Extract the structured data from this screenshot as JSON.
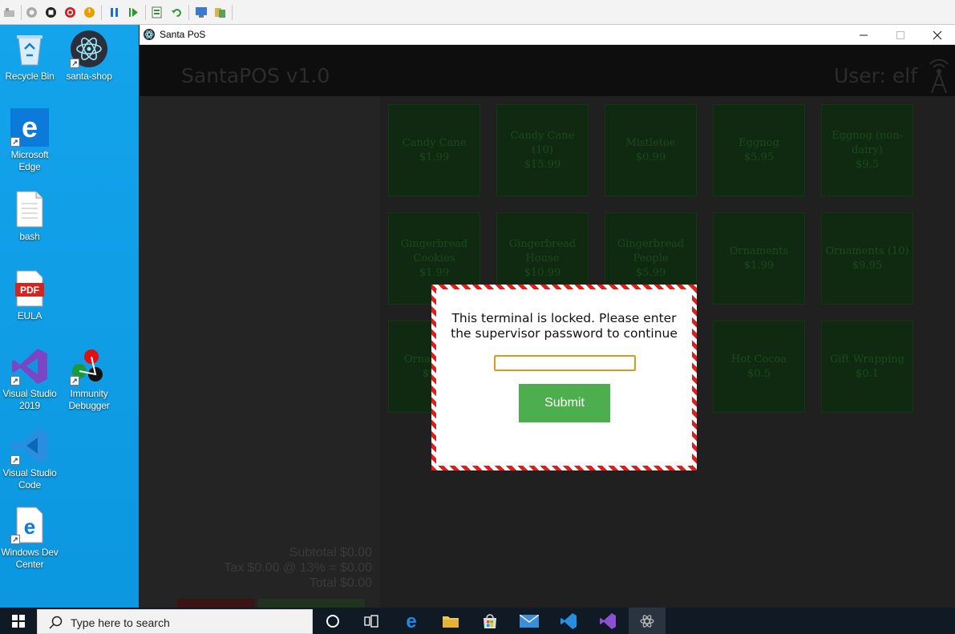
{
  "window": {
    "title": "Santa PoS",
    "minimize": "—",
    "maximize": "☐",
    "close": "✕"
  },
  "desktop_icons": [
    {
      "label": "Recycle Bin",
      "icon": "recycle-bin-icon"
    },
    {
      "label": "santa-shop",
      "icon": "electron-app-icon"
    },
    {
      "label": "Microsoft Edge",
      "icon": "edge-icon"
    },
    {
      "label": "bash",
      "icon": "file-icon"
    },
    {
      "label": "EULA",
      "icon": "pdf-icon",
      "badge": "PDF"
    },
    {
      "label": "Visual Studio 2019",
      "icon": "visual-studio-icon"
    },
    {
      "label": "Immunity Debugger",
      "icon": "immunity-debugger-icon"
    },
    {
      "label": "Visual Studio Code",
      "icon": "vscode-icon"
    },
    {
      "label": "Windows Dev Center",
      "icon": "edge-dev-center-icon"
    }
  ],
  "app": {
    "title": "SantaPOS v1.0",
    "user": "User: elf",
    "totals": {
      "subtotal": "Subtotal $0.00",
      "tax": "Tax $0.00 @ 13% = $0.00",
      "total": "Total $0.00"
    },
    "products": [
      {
        "name": "Candy Cane",
        "price": "$1.99"
      },
      {
        "name": "Candy Cane (10)",
        "price": "$15.99"
      },
      {
        "name": "Mistletoe",
        "price": "$0.99"
      },
      {
        "name": "Eggnog",
        "price": "$5.95"
      },
      {
        "name": "Eggnog (non-dairy)",
        "price": "$9.5"
      },
      {
        "name": "Gingerbread Cookies",
        "price": "$1.99"
      },
      {
        "name": "Gingerbread House",
        "price": "$10.99"
      },
      {
        "name": "Gingerbread People",
        "price": "$5.99"
      },
      {
        "name": "Ornaments",
        "price": "$1.99"
      },
      {
        "name": "Ornaments (10)",
        "price": "$9.95"
      },
      {
        "name": "Orna... (1...",
        "price": "$9..."
      },
      {
        "name": "",
        "price": ""
      },
      {
        "name": "",
        "price": ""
      },
      {
        "name": "Hot Cocoa",
        "price": "$0.5"
      },
      {
        "name": "Gift Wrapping",
        "price": "$0.1"
      }
    ]
  },
  "modal": {
    "message_line1": "This terminal is locked. Please enter",
    "message_line2": "the supervisor password to continue",
    "password_value": "",
    "submit_label": "Submit",
    "border_colors": [
      "#e31b1b",
      "#ffffff"
    ]
  },
  "taskbar": {
    "search_placeholder": "Type here to search",
    "apps": [
      "cortana-icon",
      "task-view-icon",
      "edge-icon",
      "file-explorer-icon",
      "store-icon",
      "mail-icon",
      "vscode-icon",
      "visual-studio-icon",
      "santa-pos-icon"
    ]
  },
  "colors": {
    "desktop": "#13a4ec",
    "submit": "#4cae4c",
    "input_border": "#d99a1e",
    "taskbar": "#101a24"
  }
}
